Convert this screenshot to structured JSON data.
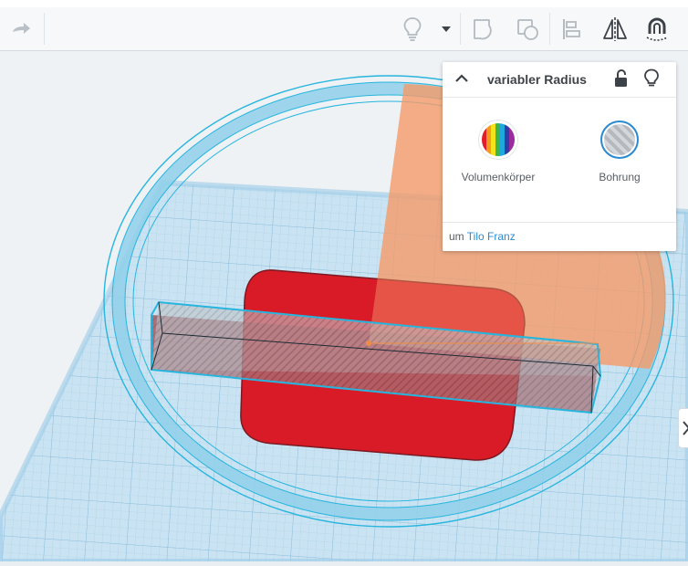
{
  "toolbar": {
    "icons": {
      "redo": "redo-arrow-icon",
      "bulb": "light-bulb-icon",
      "dropdown": "caret-down-icon",
      "group": "group-icon",
      "ungroup": "ungroup-icon",
      "align": "align-icon",
      "mirror": "mirror-icon",
      "magnet": "magnet-icon"
    }
  },
  "shape_panel": {
    "title": "variabler Radius",
    "materials": [
      {
        "label": "Volumenkörper",
        "selected": false
      },
      {
        "label": "Bohrung",
        "selected": true
      }
    ],
    "author_prefix": "um",
    "author_name": "Tilo Franz"
  },
  "colors": {
    "workplane": "#c3dff0",
    "grid_line": "#a9cfe6",
    "selection": "#27b5de",
    "shape_red": "#d91b28",
    "handle_orange": "#f08c4a",
    "hole_gray": "#9a9fa4",
    "link": "#2c8bd1"
  }
}
